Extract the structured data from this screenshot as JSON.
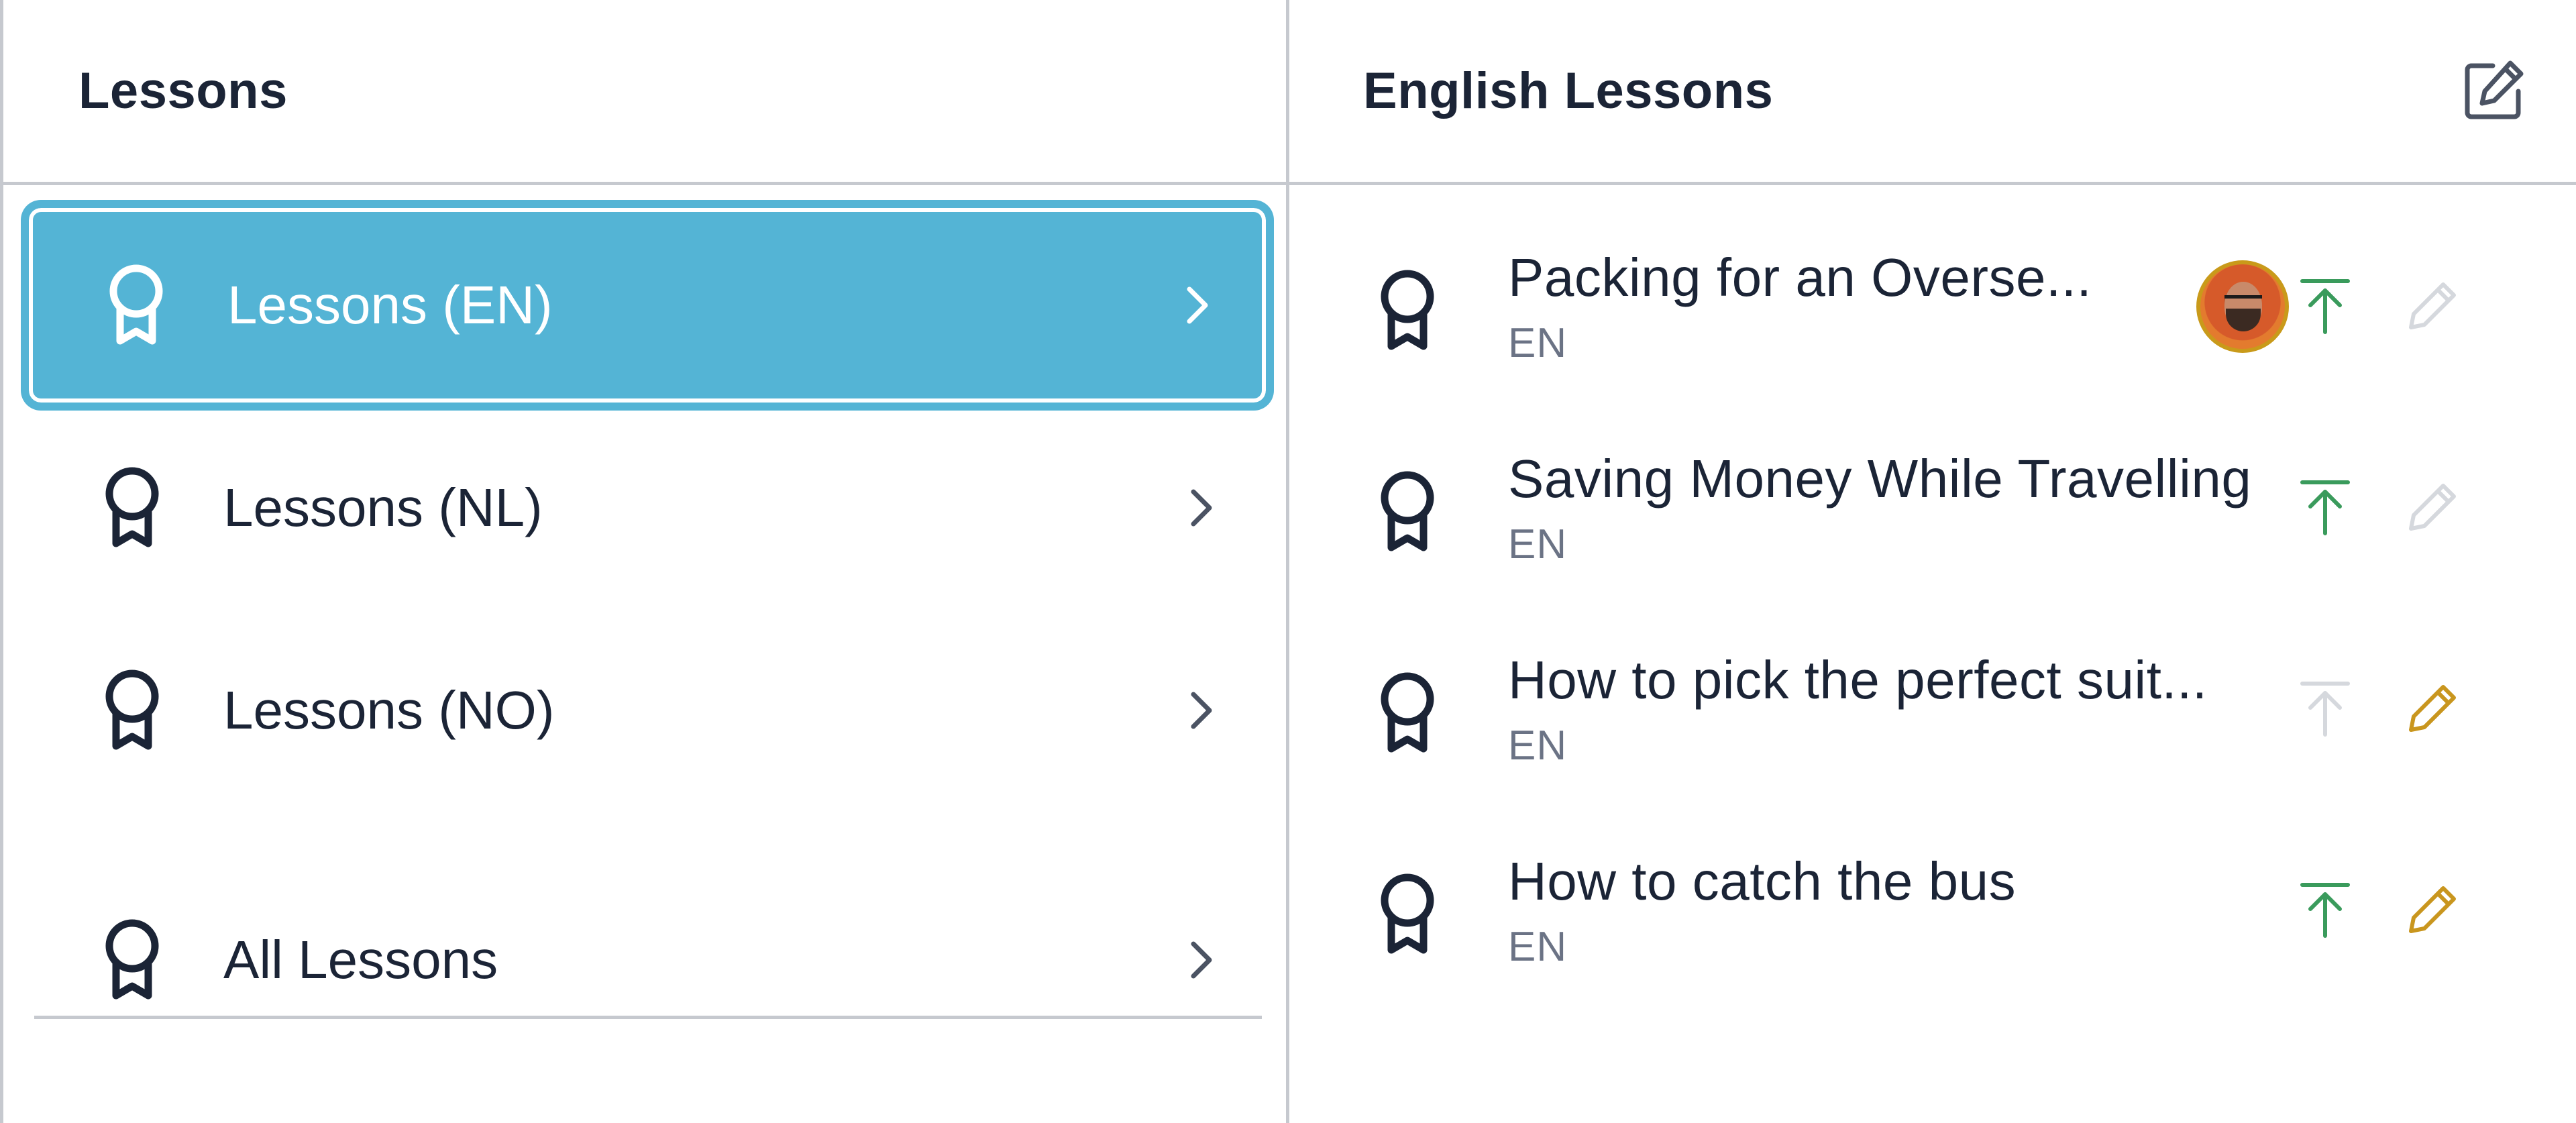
{
  "left_pane": {
    "title": "Lessons",
    "items": [
      {
        "label": "Lessons (EN)",
        "selected": true,
        "icon": "award-icon"
      },
      {
        "label": "Lessons (NL)",
        "selected": false,
        "icon": "award-icon"
      },
      {
        "label": "Lessons (NO)",
        "selected": false,
        "icon": "award-icon"
      },
      {
        "label": "All Lessons",
        "selected": false,
        "icon": "award-icon"
      }
    ]
  },
  "right_pane": {
    "title": "English Lessons",
    "edit_icon": "edit-square-icon",
    "lessons": [
      {
        "title": "Packing for an Overse...",
        "lang": "EN",
        "has_avatar": true,
        "publish_state": "active",
        "edit_state": "disabled"
      },
      {
        "title": "Saving Money While Travelling",
        "lang": "EN",
        "has_avatar": false,
        "publish_state": "active",
        "edit_state": "disabled"
      },
      {
        "title": "How to pick the perfect suit...",
        "lang": "EN",
        "has_avatar": false,
        "publish_state": "disabled",
        "edit_state": "active"
      },
      {
        "title": "How to catch the bus",
        "lang": "EN",
        "has_avatar": false,
        "publish_state": "active",
        "edit_state": "active"
      }
    ]
  },
  "colors": {
    "accent": "#54b4d5",
    "text": "#1b2436",
    "muted": "#6b7385",
    "divider": "#c6c9cf",
    "publish_active": "#3a9b5c",
    "publish_disabled": "#d5d8dd",
    "edit_active": "#c9961e",
    "edit_disabled": "#d5d8dd",
    "avatar_ring": "#c99a1a"
  }
}
